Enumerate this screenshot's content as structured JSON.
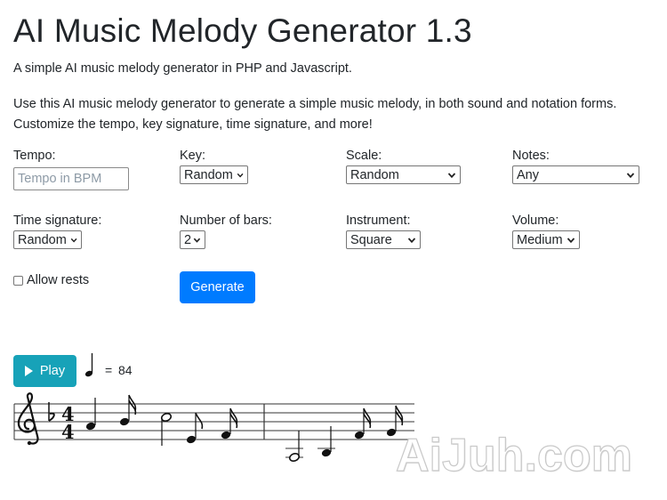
{
  "header": {
    "title": "AI Music Melody Generator 1.3",
    "subtitle": "A simple AI music melody generator in PHP and Javascript.",
    "description": "Use this AI music melody generator to generate a simple music melody, in both sound and notation forms. Customize the tempo, key signature, time signature, and more!"
  },
  "form": {
    "tempo": {
      "label": "Tempo:",
      "value": "",
      "placeholder": "Tempo in BPM"
    },
    "key": {
      "label": "Key:",
      "selected": "Random"
    },
    "scale": {
      "label": "Scale:",
      "selected": "Random"
    },
    "notes": {
      "label": "Notes:",
      "selected": "Any"
    },
    "time_signature": {
      "label": "Time signature:",
      "selected": "Random"
    },
    "number_of_bars": {
      "label": "Number of bars:",
      "selected": "2"
    },
    "instrument": {
      "label": "Instrument:",
      "selected": "Square"
    },
    "volume": {
      "label": "Volume:",
      "selected": "Medium"
    },
    "allow_rests": {
      "label": "Allow rests",
      "checked": false
    },
    "generate_label": "Generate"
  },
  "player": {
    "play_label": "Play",
    "tempo_equals": "=",
    "tempo_bpm": "84"
  },
  "notation": {
    "clef": "treble-clef-icon",
    "key_signature": "one-flat",
    "time_signature": {
      "top": "4",
      "bottom": "4"
    },
    "bars": 2
  },
  "watermark": "AiJuh.com",
  "colors": {
    "generate": "#007bff",
    "play": "#17a2b8",
    "text": "#212529"
  }
}
